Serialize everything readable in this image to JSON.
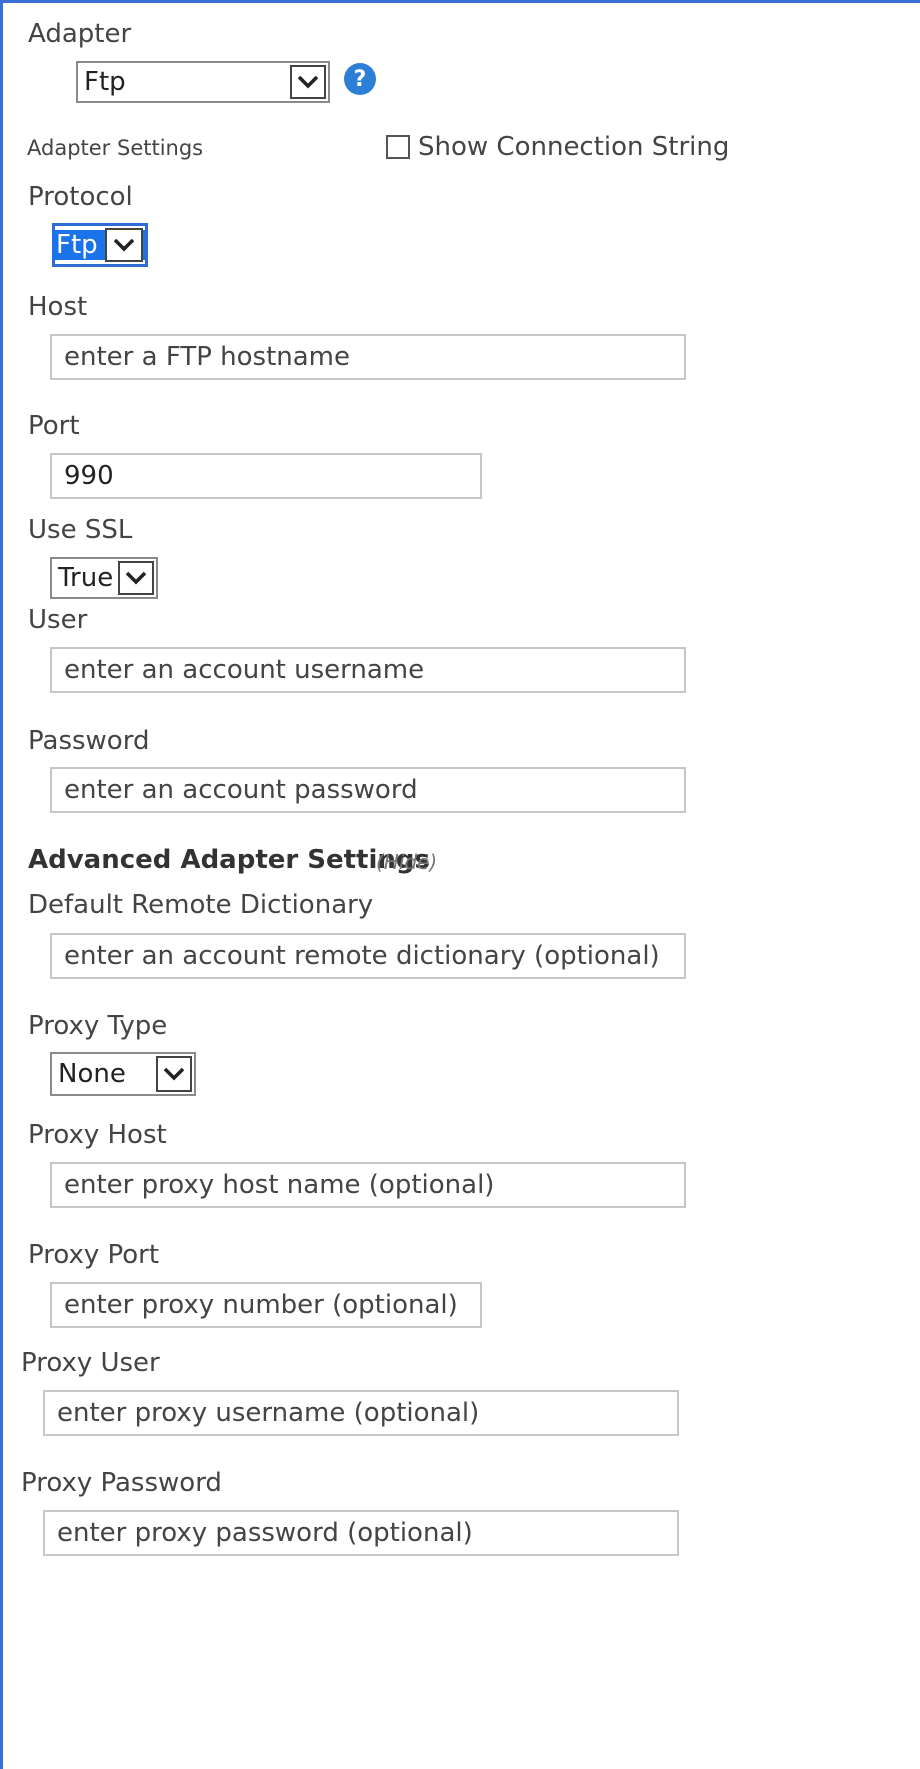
{
  "adapter": {
    "label": "Adapter",
    "selected": "Ftp",
    "help_icon": "question-icon",
    "settings_label": "Adapter Settings",
    "show_connection_string_label": "Show Connection String",
    "show_connection_string_checked": false
  },
  "protocol": {
    "label": "Protocol",
    "selected": "Ftp"
  },
  "host": {
    "label": "Host",
    "placeholder": "enter a FTP hostname"
  },
  "port": {
    "label": "Port",
    "value": "990"
  },
  "use_ssl": {
    "label": "Use SSL",
    "selected": "True"
  },
  "user": {
    "label": "User",
    "placeholder": "enter an account username"
  },
  "password": {
    "label": "Password",
    "placeholder": "enter an account password"
  },
  "advanced": {
    "title": "Advanced Adapter Settings",
    "toggle": "(Hide)"
  },
  "default_remote_dictionary": {
    "label": "Default Remote Dictionary",
    "placeholder": "enter an account remote dictionary (optional)"
  },
  "proxy_type": {
    "label": "Proxy Type",
    "selected": "None"
  },
  "proxy_host": {
    "label": "Proxy Host",
    "placeholder": "enter proxy host name (optional)"
  },
  "proxy_port": {
    "label": "Proxy Port",
    "placeholder": "enter proxy number (optional)"
  },
  "proxy_user": {
    "label": "Proxy User",
    "placeholder": "enter proxy username (optional)"
  },
  "proxy_password": {
    "label": "Proxy Password",
    "placeholder": "enter proxy password (optional)"
  },
  "colors": {
    "frame": "#3a6fd8",
    "selection": "#1a73e8",
    "help": "#2c7fd6"
  }
}
